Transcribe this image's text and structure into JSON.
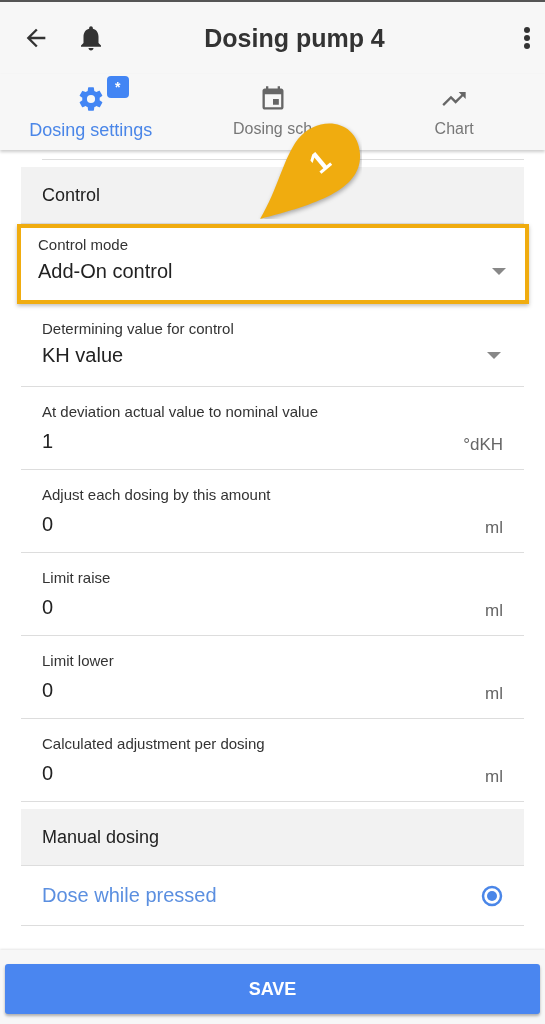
{
  "app_bar": {
    "title": "Dosing pump 4"
  },
  "tabs": [
    {
      "label": "Dosing settings",
      "badge": "*",
      "selected": true
    },
    {
      "label": "Dosing sch",
      "selected": false
    },
    {
      "label": "Chart",
      "selected": false
    }
  ],
  "callout": {
    "label": "1"
  },
  "sections": [
    {
      "title": "Control",
      "fields": [
        {
          "kind": "select",
          "label": "Control mode",
          "value": "Add-On control",
          "highlighted": true
        },
        {
          "kind": "select",
          "label": "Determining value for control",
          "value": "KH value",
          "highlighted": false
        },
        {
          "kind": "number",
          "label": "At deviation actual value to nominal value",
          "value": "1",
          "unit": "°dKH",
          "highlighted": false
        },
        {
          "kind": "number",
          "label": "Adjust each dosing by this amount",
          "value": "0",
          "unit": "ml",
          "highlighted": false
        },
        {
          "kind": "number",
          "label": "Limit raise",
          "value": "0",
          "unit": "ml",
          "highlighted": false
        },
        {
          "kind": "number",
          "label": "Limit lower",
          "value": "0",
          "unit": "ml",
          "highlighted": false
        },
        {
          "kind": "number",
          "label": "Calculated adjustment per dosing",
          "value": "0",
          "unit": "ml",
          "highlighted": false
        }
      ]
    },
    {
      "title": "Manual dosing",
      "fields": [
        {
          "kind": "radio",
          "label": "Dose while pressed",
          "selected": true
        }
      ]
    }
  ],
  "save_button": {
    "label": "SAVE"
  }
}
